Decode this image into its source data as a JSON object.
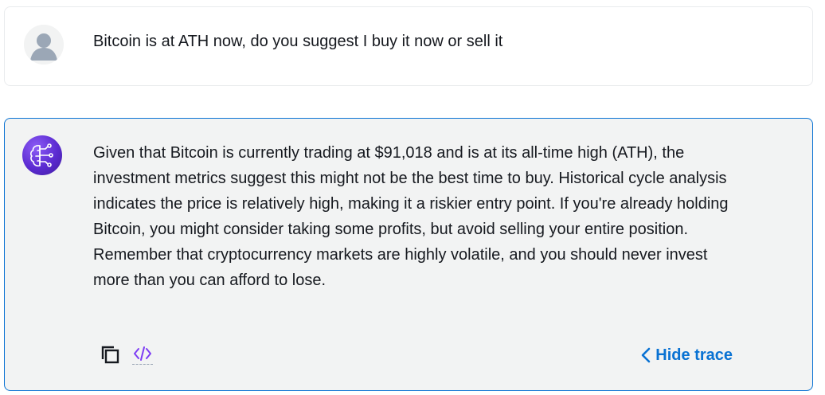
{
  "user_message": {
    "text": "Bitcoin is at ATH now, do you suggest I buy it now or sell it",
    "avatar_icon": "user-avatar-icon"
  },
  "assistant_message": {
    "text": "Given that Bitcoin is currently trading at $91,018 and is at its all-time high (ATH), the investment metrics suggest this might not be the best time to buy. Historical cycle analysis indicates the price is relatively high, making it a riskier entry point. If you're already holding Bitcoin, you might consider taking some profits, but avoid selling your entire position. Remember that cryptocurrency markets are highly volatile, and you should never invest more than you can afford to lose.",
    "avatar_icon": "ai-brain-icon",
    "actions": {
      "copy_icon": "copy-icon",
      "code_icon": "code-icon",
      "hide_trace_label": "Hide trace",
      "hide_trace_icon": "chevron-left-icon"
    }
  },
  "colors": {
    "accent": "#0972d3",
    "assistant_background": "#f2f3f3",
    "text": "#16191f",
    "code_icon": "#7d3cf4"
  }
}
